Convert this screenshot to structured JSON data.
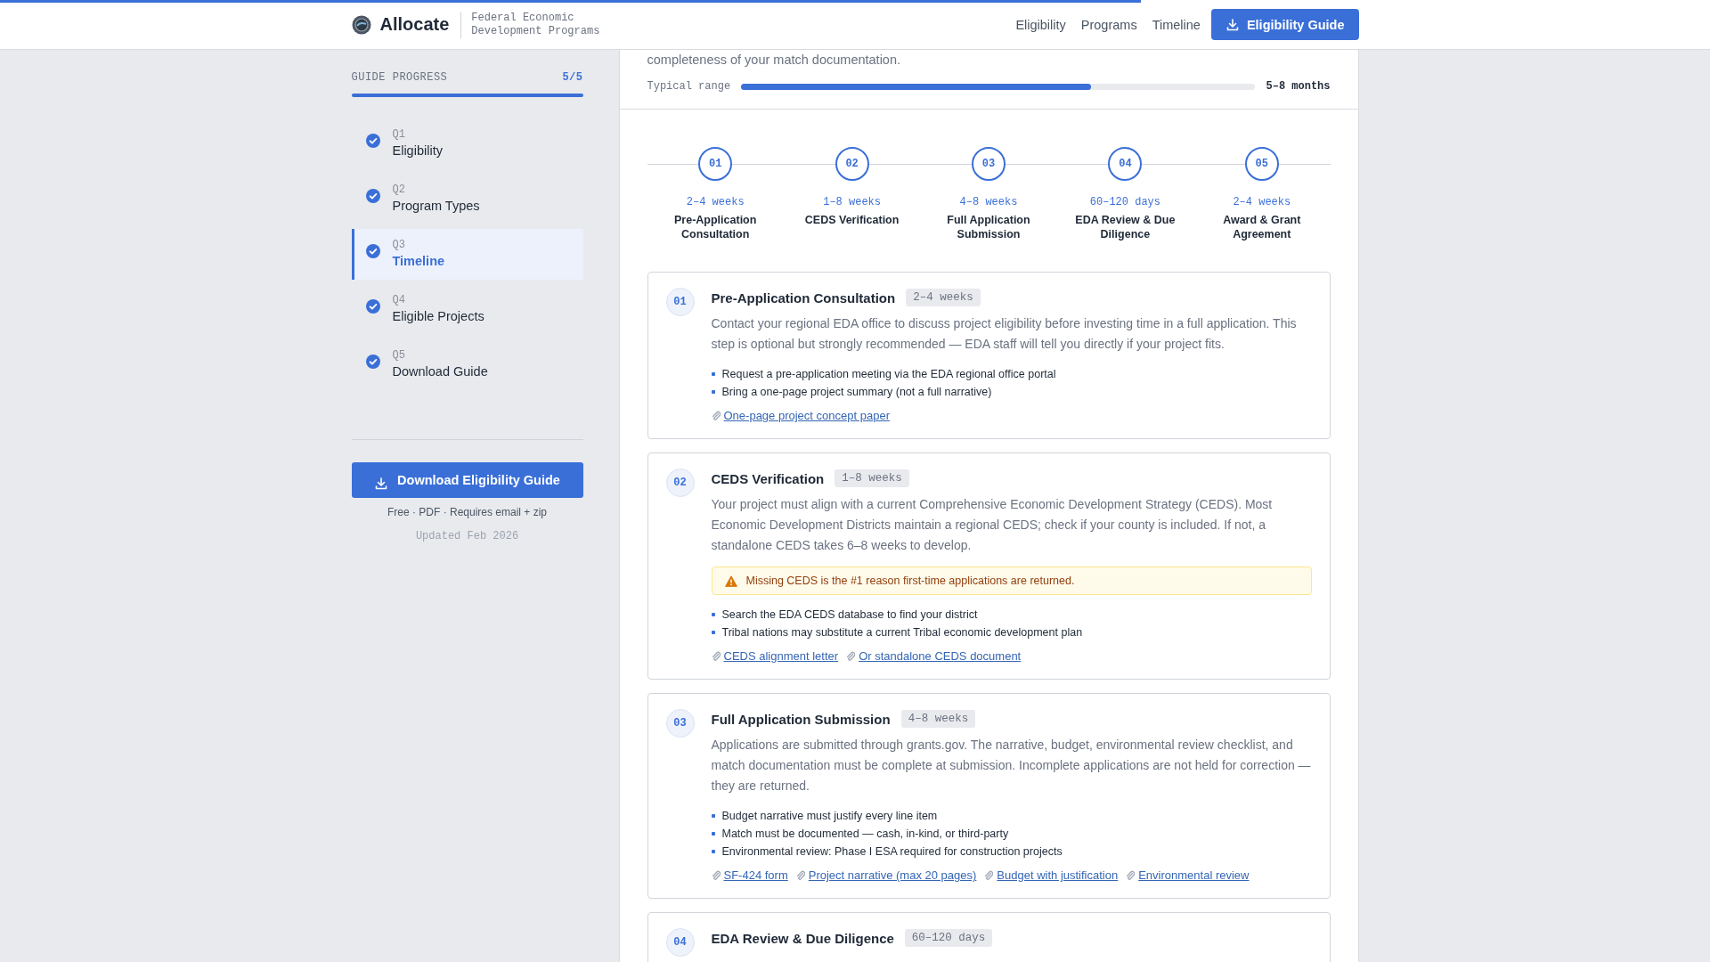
{
  "reading_progress": {
    "level": 0.667
  },
  "header": {
    "logo": "Allocate",
    "subtitle": "Federal Economic Development Programs",
    "nav": [
      "Eligibility",
      "Programs",
      "Timeline"
    ],
    "cta": "Eligibility Guide"
  },
  "sidebar": {
    "title": "GUIDE PROGRESS",
    "count": "5/5",
    "level": 1,
    "items": [
      {
        "number": "Q1",
        "label": "Eligibility",
        "done": true,
        "selected": false
      },
      {
        "number": "Q2",
        "label": "Program Types",
        "done": true,
        "selected": false
      },
      {
        "number": "Q3",
        "label": "Timeline",
        "done": true,
        "selected": true
      },
      {
        "number": "Q4",
        "label": "Eligible Projects",
        "done": true,
        "selected": false
      },
      {
        "number": "Q5",
        "label": "Download Guide",
        "done": true,
        "selected": false
      }
    ],
    "download_button": "Download Eligibility Guide",
    "note": "Free · PDF · Requires email + zip",
    "updated": "Updated Feb 2026"
  },
  "summary": {
    "text": "completeness of your match documentation.",
    "range_label": "Typical range",
    "level": 0.68,
    "range_value": "5–8 months"
  },
  "timeline": [
    {
      "number": "01",
      "duration": "2–4 weeks",
      "label": "Pre-Application Consultation"
    },
    {
      "number": "02",
      "duration": "1–8 weeks",
      "label": "CEDS Verification"
    },
    {
      "number": "03",
      "duration": "4–8 weeks",
      "label": "Full Application Submission"
    },
    {
      "number": "04",
      "duration": "60–120 days",
      "label": "EDA Review & Due Diligence"
    },
    {
      "number": "05",
      "duration": "2–4 weeks",
      "label": "Award & Grant Agreement"
    }
  ],
  "steps": [
    {
      "number": "01",
      "title": "Pre-Application Consultation",
      "duration": "2–4 weeks",
      "description": "Contact your regional EDA office to discuss project eligibility before investing time in a full application. This step is optional but strongly recommended — EDA staff will tell you directly if your project fits.",
      "bullets": [
        "Request a pre-application meeting via the EDA regional office portal",
        "Bring a one-page project summary (not a full narrative)"
      ],
      "attachments": [
        "One-page project concept paper"
      ]
    },
    {
      "number": "02",
      "title": "CEDS Verification",
      "duration": "1–8 weeks",
      "description": "Your project must align with a current Comprehensive Economic Development Strategy (CEDS). Most Economic Development Districts maintain a regional CEDS; check if your county is included. If not, a standalone CEDS takes 6–8 weeks to develop.",
      "warning": "Missing CEDS is the #1 reason first-time applications are returned.",
      "bullets": [
        "Search the EDA CEDS database to find your district",
        "Tribal nations may substitute a current Tribal economic development plan"
      ],
      "attachments": [
        "CEDS alignment letter",
        "Or standalone CEDS document"
      ]
    },
    {
      "number": "03",
      "title": "Full Application Submission",
      "duration": "4–8 weeks",
      "description": "Applications are submitted through grants.gov. The narrative, budget, environmental review checklist, and match documentation must be complete at submission. Incomplete applications are not held for correction — they are returned.",
      "bullets": [
        "Budget narrative must justify every line item",
        "Match must be documented — cash, in-kind, or third-party",
        "Environmental review: Phase I ESA required for construction projects"
      ],
      "attachments": [
        "SF-424 form",
        "Project narrative (max 20 pages)",
        "Budget with justification",
        "Environmental review"
      ]
    },
    {
      "number": "04",
      "title": "EDA Review & Due Diligence",
      "duration": "60–120 days"
    }
  ]
}
